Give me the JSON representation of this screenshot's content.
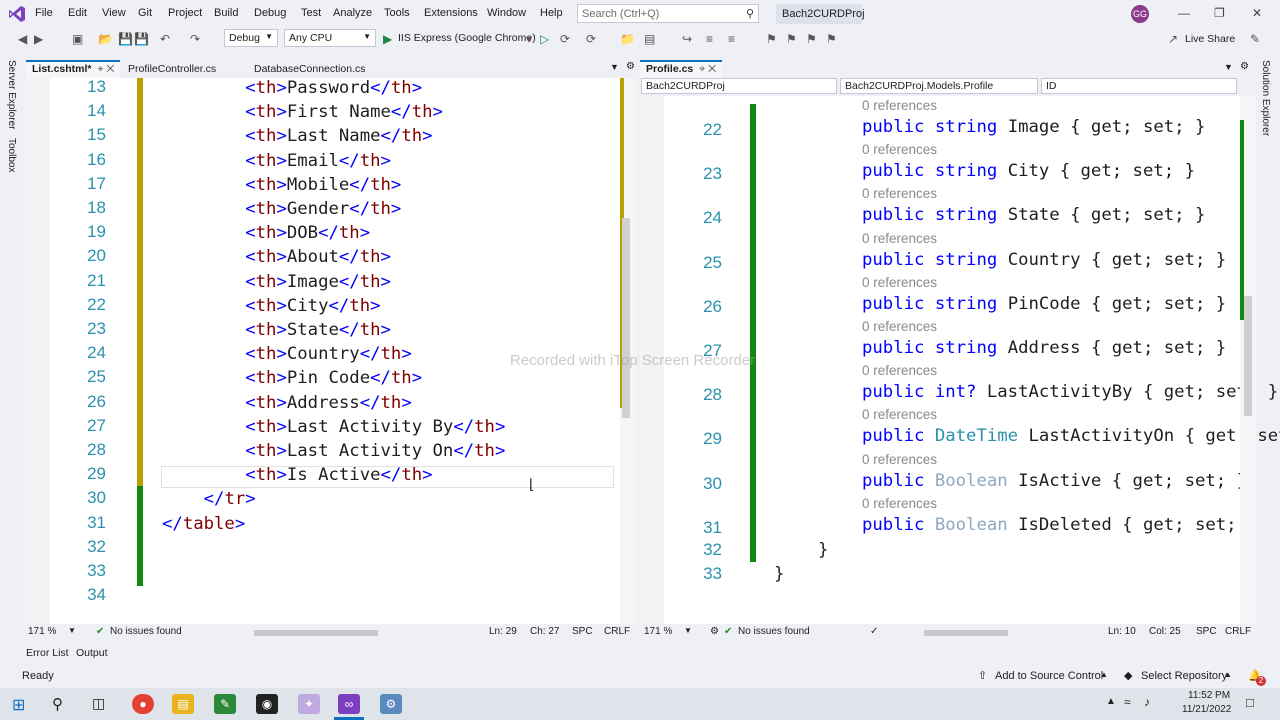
{
  "menu": [
    "File",
    "Edit",
    "View",
    "Git",
    "Project",
    "Build",
    "Debug",
    "Test",
    "Analyze",
    "Tools",
    "Extensions",
    "Window",
    "Help"
  ],
  "search": {
    "placeholder": "Search (Ctrl+Q)"
  },
  "solution_name": "Bach2CURDProj",
  "avatar_initials": "GG",
  "toolbar": {
    "config": "Debug",
    "platform": "Any CPU",
    "run_target": "IIS Express (Google Chrome)",
    "live_share": "Live Share"
  },
  "left_sidebar": {
    "server_explorer": "Server Explorer",
    "toolbox": "Toolbox"
  },
  "right_sidebar": {
    "solution_explorer": "Solution Explorer"
  },
  "left_editor": {
    "tabs": [
      {
        "label": "List.cshtml*",
        "active": true
      },
      {
        "label": "ProfileController.cs",
        "active": false
      },
      {
        "label": "DatabaseConnection.cs",
        "active": false
      }
    ],
    "lines": [
      {
        "n": "13",
        "indent": "        ",
        "tag": "th",
        "text": "Password"
      },
      {
        "n": "14",
        "indent": "        ",
        "tag": "th",
        "text": "First Name"
      },
      {
        "n": "15",
        "indent": "        ",
        "tag": "th",
        "text": "Last Name"
      },
      {
        "n": "16",
        "indent": "        ",
        "tag": "th",
        "text": "Email"
      },
      {
        "n": "17",
        "indent": "        ",
        "tag": "th",
        "text": "Mobile"
      },
      {
        "n": "18",
        "indent": "        ",
        "tag": "th",
        "text": "Gender"
      },
      {
        "n": "19",
        "indent": "        ",
        "tag": "th",
        "text": "DOB"
      },
      {
        "n": "20",
        "indent": "        ",
        "tag": "th",
        "text": "About"
      },
      {
        "n": "21",
        "indent": "        ",
        "tag": "th",
        "text": "Image"
      },
      {
        "n": "22",
        "indent": "        ",
        "tag": "th",
        "text": "City"
      },
      {
        "n": "23",
        "indent": "        ",
        "tag": "th",
        "text": "State"
      },
      {
        "n": "24",
        "indent": "        ",
        "tag": "th",
        "text": "Country"
      },
      {
        "n": "25",
        "indent": "        ",
        "tag": "th",
        "text": "Pin Code"
      },
      {
        "n": "26",
        "indent": "        ",
        "tag": "th",
        "text": "Address"
      },
      {
        "n": "27",
        "indent": "        ",
        "tag": "th",
        "text": "Last Activity By"
      },
      {
        "n": "28",
        "indent": "        ",
        "tag": "th",
        "text": "Last Activity On"
      },
      {
        "n": "29",
        "indent": "        ",
        "tag": "th",
        "text": "Is Active"
      },
      {
        "n": "30",
        "indent": "    ",
        "close": "tr"
      },
      {
        "n": "31",
        "indent": "",
        "close": "table"
      },
      {
        "n": "32",
        "indent": ""
      },
      {
        "n": "33",
        "indent": ""
      },
      {
        "n": "34",
        "indent": ""
      }
    ],
    "status": {
      "zoom": "171 %",
      "issues": "No issues found",
      "ln": "Ln: 29",
      "ch": "Ch: 27",
      "spc": "SPC",
      "eol": "CRLF"
    }
  },
  "right_editor": {
    "tabs": [
      {
        "label": "Profile.cs",
        "active": true
      }
    ],
    "nav": {
      "project": "Bach2CURDProj",
      "type": "Bach2CURDProj.Models.Profile",
      "member": "ID"
    },
    "references_label": "0 references",
    "lines": [
      {
        "n": "22",
        "kw": "public",
        "type": "string",
        "name": "Image",
        "acc": "{ get; set; }"
      },
      {
        "n": "23",
        "kw": "public",
        "type": "string",
        "name": "City",
        "acc": "{ get; set; }"
      },
      {
        "n": "24",
        "kw": "public",
        "type": "string",
        "name": "State",
        "acc": "{ get; set; }"
      },
      {
        "n": "25",
        "kw": "public",
        "type": "string",
        "name": "Country",
        "acc": "{ get; set; }"
      },
      {
        "n": "26",
        "kw": "public",
        "type": "string",
        "name": "PinCode",
        "acc": "{ get; set; }"
      },
      {
        "n": "27",
        "kw": "public",
        "type": "string",
        "name": "Address",
        "acc": "{ get; set; }"
      },
      {
        "n": "28",
        "kw": "public",
        "type": "int?",
        "name": "LastActivityBy",
        "acc": "{ get; set; }"
      },
      {
        "n": "29",
        "kw": "public",
        "type": "DateTime",
        "name": "LastActivityOn",
        "acc": "{ get; set; }"
      },
      {
        "n": "30",
        "kw": "public",
        "type": "Boolean",
        "name": "IsActive",
        "acc": "{ get; set; }"
      },
      {
        "n": "31",
        "kw": "public",
        "type": "Boolean",
        "name": "IsDeleted",
        "acc": "{ get; set; }"
      }
    ],
    "closing": [
      {
        "n": "32",
        "text": "}"
      },
      {
        "n": "33",
        "text": "}"
      }
    ],
    "status": {
      "zoom": "171 %",
      "issues": "No issues found",
      "ln": "Ln: 10",
      "ch": "Col: 25",
      "spc": "SPC",
      "eol": "CRLF"
    }
  },
  "bottom_tabs": [
    "Error List",
    "Output"
  ],
  "statusbar": {
    "ready": "Ready",
    "source_control": "Add to Source Control",
    "repo": "Select Repository",
    "notif_count": "2"
  },
  "watermark": "Recorded with iTop Screen Recorder",
  "taskbar": {
    "time": "11:52 PM",
    "date": "11/21/2022"
  }
}
